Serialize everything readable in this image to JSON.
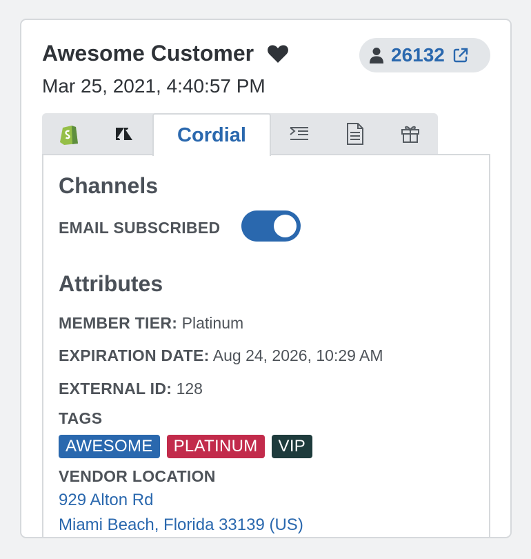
{
  "customer": {
    "name": "Awesome Customer",
    "date": "Mar 25, 2021, 4:40:57 PM",
    "id": "26132"
  },
  "tabs": [
    {
      "icon": "shopify-icon"
    },
    {
      "icon": "zendesk-icon"
    },
    {
      "label": "Cordial",
      "active": true
    },
    {
      "icon": "list-indent-icon"
    },
    {
      "icon": "document-icon"
    },
    {
      "icon": "gift-icon"
    }
  ],
  "channels": {
    "title": "Channels",
    "email_label": "EMAIL SUBSCRIBED",
    "email_subscribed": true
  },
  "attributes": {
    "title": "Attributes",
    "member_tier_label": "MEMBER TIER:",
    "member_tier": "Platinum",
    "expiration_label": "EXPIRATION DATE:",
    "expiration": "Aug 24, 2026, 10:29 AM",
    "external_id_label": "EXTERNAL ID:",
    "external_id": "128",
    "tags_label": "TAGS",
    "tags": [
      {
        "label": "AWESOME",
        "color": "#2a68ae"
      },
      {
        "label": "PLATINUM",
        "color": "#c22b4b"
      },
      {
        "label": "VIP",
        "color": "#1e3b3c"
      }
    ],
    "vendor_location_label": "VENDOR LOCATION",
    "address_line1": "929 Alton Rd",
    "address_line2": "Miami Beach, Florida 33139 (US)"
  },
  "colors": {
    "accent": "#2a68ae",
    "text": "#2f3338",
    "tab_bg": "#e3e5e8"
  }
}
